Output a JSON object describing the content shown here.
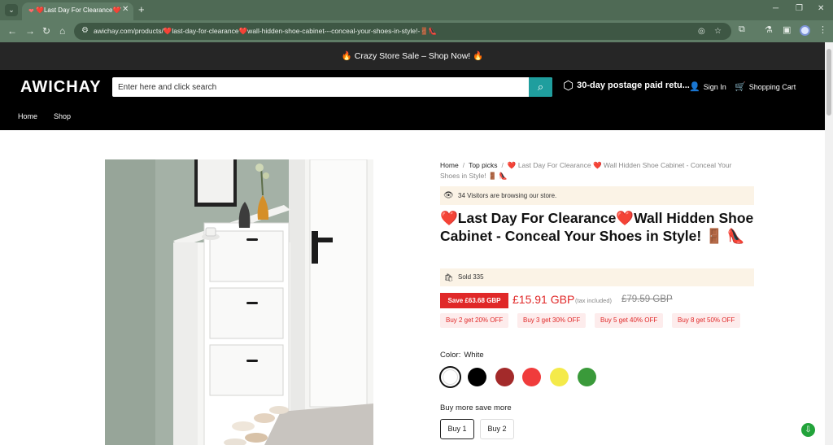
{
  "browser": {
    "tab_title": "❤️Last Day For Clearance❤️W",
    "url": "awichay.com/products/❤️last-day-for-clearance❤️wall-hidden-shoe-cabinet---conceal-your-shoes-in-style!-🚪👠",
    "icons": {
      "tab_menu": "⌄",
      "close": "✕",
      "new_tab": "+",
      "minimize": "─",
      "restore": "❐",
      "window_close": "✕",
      "back": "←",
      "forward": "→",
      "reload": "↻",
      "home": "⌂",
      "site_settings": "⚙",
      "hide": "◎",
      "bookmark": "☆",
      "extensions": "⧉",
      "labs": "⚗",
      "side_panel": "▣",
      "menu": "⋮"
    }
  },
  "promo": {
    "text": "🔥 Crazy Store Sale – Shop Now! 🔥"
  },
  "header": {
    "logo": "AWICHAY",
    "search_placeholder": "Enter here and click search",
    "search_icon": "⌕",
    "postage": "30-day postage paid retu...",
    "postage_icon": "⬡",
    "sign_in": "Sign In",
    "sign_in_icon": "👤",
    "cart": "Shopping Cart",
    "cart_icon": "🛒"
  },
  "nav": {
    "home": "Home",
    "shop": "Shop"
  },
  "breadcrumb": {
    "home": "Home",
    "top_picks": "Top picks",
    "current": "❤️ Last Day For Clearance ❤️ Wall Hidden Shoe Cabinet - Conceal Your Shoes in Style! 🚪 👠",
    "separator": "/"
  },
  "visitors": {
    "icon": "👁",
    "text": "34 Visitors are browsing our store."
  },
  "product": {
    "title": "❤️Last Day For Clearance❤️Wall Hidden Shoe Cabinet - Conceal Your Shoes in Style! 🚪 👠",
    "sold_icon": "🛍",
    "sold": "Sold 335",
    "save_badge": "Save £63.68 GBP",
    "price": "£15.91 GBP",
    "tax_note": "(tax included)",
    "compare_price": "£79.59 GBP",
    "offers": [
      "Buy 2 get 20% OFF",
      "Buy 3 get 30% OFF",
      "Buy 5 get 40% OFF",
      "Buy 8 get 50% OFF"
    ],
    "color_label": "Color:",
    "color_value": "White",
    "colors": [
      "#ffffff",
      "#000000",
      "#a32a2a",
      "#f03c3c",
      "#f4ea4a",
      "#3a9a3a"
    ],
    "buy_more_label": "Buy more save more",
    "quantity_options": [
      "Buy 1",
      "Buy 2"
    ]
  },
  "chat_icon": "⇩"
}
